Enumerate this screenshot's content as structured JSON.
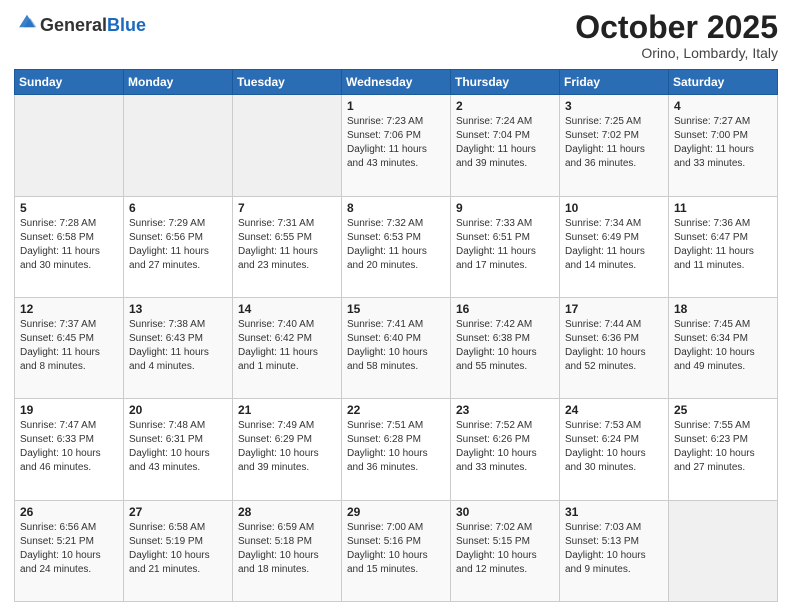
{
  "header": {
    "logo_general": "General",
    "logo_blue": "Blue",
    "month_title": "October 2025",
    "location": "Orino, Lombardy, Italy"
  },
  "days_of_week": [
    "Sunday",
    "Monday",
    "Tuesday",
    "Wednesday",
    "Thursday",
    "Friday",
    "Saturday"
  ],
  "weeks": [
    [
      {
        "day": "",
        "sunrise": "",
        "sunset": "",
        "daylight": "",
        "empty": true
      },
      {
        "day": "",
        "sunrise": "",
        "sunset": "",
        "daylight": "",
        "empty": true
      },
      {
        "day": "",
        "sunrise": "",
        "sunset": "",
        "daylight": "",
        "empty": true
      },
      {
        "day": "1",
        "sunrise": "Sunrise: 7:23 AM",
        "sunset": "Sunset: 7:06 PM",
        "daylight": "Daylight: 11 hours and 43 minutes.",
        "empty": false
      },
      {
        "day": "2",
        "sunrise": "Sunrise: 7:24 AM",
        "sunset": "Sunset: 7:04 PM",
        "daylight": "Daylight: 11 hours and 39 minutes.",
        "empty": false
      },
      {
        "day": "3",
        "sunrise": "Sunrise: 7:25 AM",
        "sunset": "Sunset: 7:02 PM",
        "daylight": "Daylight: 11 hours and 36 minutes.",
        "empty": false
      },
      {
        "day": "4",
        "sunrise": "Sunrise: 7:27 AM",
        "sunset": "Sunset: 7:00 PM",
        "daylight": "Daylight: 11 hours and 33 minutes.",
        "empty": false
      }
    ],
    [
      {
        "day": "5",
        "sunrise": "Sunrise: 7:28 AM",
        "sunset": "Sunset: 6:58 PM",
        "daylight": "Daylight: 11 hours and 30 minutes.",
        "empty": false
      },
      {
        "day": "6",
        "sunrise": "Sunrise: 7:29 AM",
        "sunset": "Sunset: 6:56 PM",
        "daylight": "Daylight: 11 hours and 27 minutes.",
        "empty": false
      },
      {
        "day": "7",
        "sunrise": "Sunrise: 7:31 AM",
        "sunset": "Sunset: 6:55 PM",
        "daylight": "Daylight: 11 hours and 23 minutes.",
        "empty": false
      },
      {
        "day": "8",
        "sunrise": "Sunrise: 7:32 AM",
        "sunset": "Sunset: 6:53 PM",
        "daylight": "Daylight: 11 hours and 20 minutes.",
        "empty": false
      },
      {
        "day": "9",
        "sunrise": "Sunrise: 7:33 AM",
        "sunset": "Sunset: 6:51 PM",
        "daylight": "Daylight: 11 hours and 17 minutes.",
        "empty": false
      },
      {
        "day": "10",
        "sunrise": "Sunrise: 7:34 AM",
        "sunset": "Sunset: 6:49 PM",
        "daylight": "Daylight: 11 hours and 14 minutes.",
        "empty": false
      },
      {
        "day": "11",
        "sunrise": "Sunrise: 7:36 AM",
        "sunset": "Sunset: 6:47 PM",
        "daylight": "Daylight: 11 hours and 11 minutes.",
        "empty": false
      }
    ],
    [
      {
        "day": "12",
        "sunrise": "Sunrise: 7:37 AM",
        "sunset": "Sunset: 6:45 PM",
        "daylight": "Daylight: 11 hours and 8 minutes.",
        "empty": false
      },
      {
        "day": "13",
        "sunrise": "Sunrise: 7:38 AM",
        "sunset": "Sunset: 6:43 PM",
        "daylight": "Daylight: 11 hours and 4 minutes.",
        "empty": false
      },
      {
        "day": "14",
        "sunrise": "Sunrise: 7:40 AM",
        "sunset": "Sunset: 6:42 PM",
        "daylight": "Daylight: 11 hours and 1 minute.",
        "empty": false
      },
      {
        "day": "15",
        "sunrise": "Sunrise: 7:41 AM",
        "sunset": "Sunset: 6:40 PM",
        "daylight": "Daylight: 10 hours and 58 minutes.",
        "empty": false
      },
      {
        "day": "16",
        "sunrise": "Sunrise: 7:42 AM",
        "sunset": "Sunset: 6:38 PM",
        "daylight": "Daylight: 10 hours and 55 minutes.",
        "empty": false
      },
      {
        "day": "17",
        "sunrise": "Sunrise: 7:44 AM",
        "sunset": "Sunset: 6:36 PM",
        "daylight": "Daylight: 10 hours and 52 minutes.",
        "empty": false
      },
      {
        "day": "18",
        "sunrise": "Sunrise: 7:45 AM",
        "sunset": "Sunset: 6:34 PM",
        "daylight": "Daylight: 10 hours and 49 minutes.",
        "empty": false
      }
    ],
    [
      {
        "day": "19",
        "sunrise": "Sunrise: 7:47 AM",
        "sunset": "Sunset: 6:33 PM",
        "daylight": "Daylight: 10 hours and 46 minutes.",
        "empty": false
      },
      {
        "day": "20",
        "sunrise": "Sunrise: 7:48 AM",
        "sunset": "Sunset: 6:31 PM",
        "daylight": "Daylight: 10 hours and 43 minutes.",
        "empty": false
      },
      {
        "day": "21",
        "sunrise": "Sunrise: 7:49 AM",
        "sunset": "Sunset: 6:29 PM",
        "daylight": "Daylight: 10 hours and 39 minutes.",
        "empty": false
      },
      {
        "day": "22",
        "sunrise": "Sunrise: 7:51 AM",
        "sunset": "Sunset: 6:28 PM",
        "daylight": "Daylight: 10 hours and 36 minutes.",
        "empty": false
      },
      {
        "day": "23",
        "sunrise": "Sunrise: 7:52 AM",
        "sunset": "Sunset: 6:26 PM",
        "daylight": "Daylight: 10 hours and 33 minutes.",
        "empty": false
      },
      {
        "day": "24",
        "sunrise": "Sunrise: 7:53 AM",
        "sunset": "Sunset: 6:24 PM",
        "daylight": "Daylight: 10 hours and 30 minutes.",
        "empty": false
      },
      {
        "day": "25",
        "sunrise": "Sunrise: 7:55 AM",
        "sunset": "Sunset: 6:23 PM",
        "daylight": "Daylight: 10 hours and 27 minutes.",
        "empty": false
      }
    ],
    [
      {
        "day": "26",
        "sunrise": "Sunrise: 6:56 AM",
        "sunset": "Sunset: 5:21 PM",
        "daylight": "Daylight: 10 hours and 24 minutes.",
        "empty": false
      },
      {
        "day": "27",
        "sunrise": "Sunrise: 6:58 AM",
        "sunset": "Sunset: 5:19 PM",
        "daylight": "Daylight: 10 hours and 21 minutes.",
        "empty": false
      },
      {
        "day": "28",
        "sunrise": "Sunrise: 6:59 AM",
        "sunset": "Sunset: 5:18 PM",
        "daylight": "Daylight: 10 hours and 18 minutes.",
        "empty": false
      },
      {
        "day": "29",
        "sunrise": "Sunrise: 7:00 AM",
        "sunset": "Sunset: 5:16 PM",
        "daylight": "Daylight: 10 hours and 15 minutes.",
        "empty": false
      },
      {
        "day": "30",
        "sunrise": "Sunrise: 7:02 AM",
        "sunset": "Sunset: 5:15 PM",
        "daylight": "Daylight: 10 hours and 12 minutes.",
        "empty": false
      },
      {
        "day": "31",
        "sunrise": "Sunrise: 7:03 AM",
        "sunset": "Sunset: 5:13 PM",
        "daylight": "Daylight: 10 hours and 9 minutes.",
        "empty": false
      },
      {
        "day": "",
        "sunrise": "",
        "sunset": "",
        "daylight": "",
        "empty": true
      }
    ]
  ]
}
